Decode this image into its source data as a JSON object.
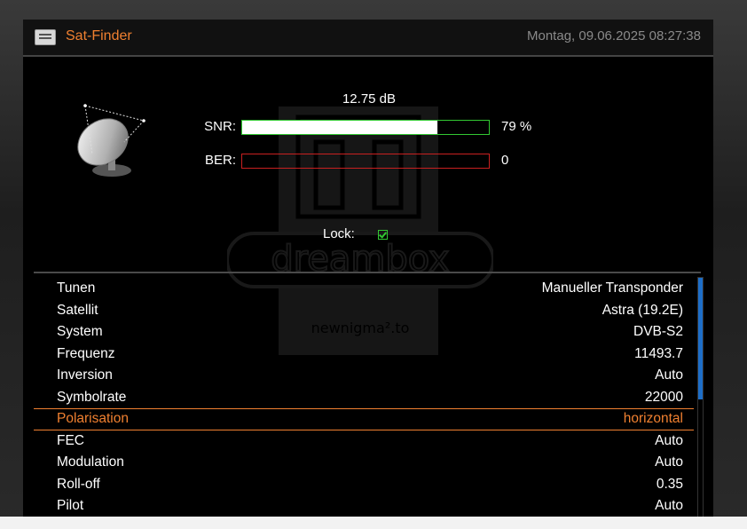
{
  "header": {
    "title": "Sat-Finder",
    "datetime": "Montag, 09.06.2025 08:27:38",
    "icon": "tv-guide-icon"
  },
  "signal": {
    "snr_db": "12.75 dB",
    "snr_label": "SNR:",
    "snr_percent_text": "79 %",
    "snr_fraction": 0.79,
    "ber_label": "BER:",
    "ber_value": "0",
    "ber_fraction": 0,
    "lock_label": "Lock:",
    "locked": true
  },
  "settings": {
    "items": [
      {
        "label": "Tunen",
        "value": "Manueller Transponder"
      },
      {
        "label": "Satellit",
        "value": "Astra (19.2E)"
      },
      {
        "label": "System",
        "value": "DVB-S2"
      },
      {
        "label": "Frequenz",
        "value": "11493.7"
      },
      {
        "label": "Inversion",
        "value": "Auto"
      },
      {
        "label": "Symbolrate",
        "value": "22000"
      },
      {
        "label": "Polarisation",
        "value": "horizontal"
      },
      {
        "label": "FEC",
        "value": "Auto"
      },
      {
        "label": "Modulation",
        "value": "Auto"
      },
      {
        "label": "Roll-off",
        "value": "0.35"
      },
      {
        "label": "Pilot",
        "value": "Auto"
      }
    ],
    "selected_index": 6
  },
  "watermark": {
    "brand": "dreambox",
    "site": "newnigma².to"
  },
  "colors": {
    "accent": "#f08030",
    "snr_border": "#32c832",
    "ber_border": "#c82020",
    "scrollbar": "#1d6ec8"
  }
}
